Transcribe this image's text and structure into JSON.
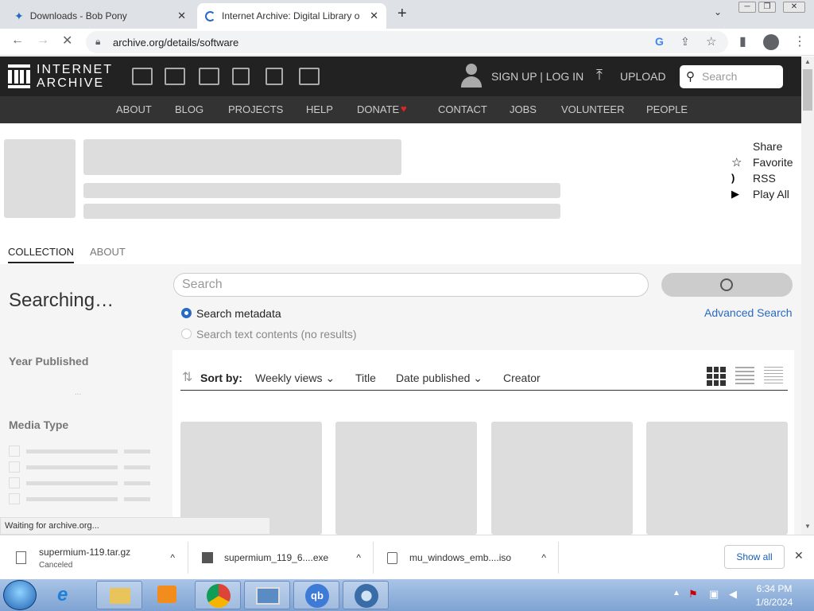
{
  "browser": {
    "tabs": [
      {
        "title": "Downloads - Bob Pony",
        "active": false
      },
      {
        "title": "Internet Archive: Digital Library o",
        "active": true
      }
    ],
    "url": "archive.org/details/software"
  },
  "ia": {
    "logo_line1": "INTERNET",
    "logo_line2": "ARCHIVE",
    "signup": "SIGN UP | LOG IN",
    "upload": "UPLOAD",
    "search_placeholder": "Search",
    "subnav": [
      "ABOUT",
      "BLOG",
      "PROJECTS",
      "HELP",
      "DONATE",
      "CONTACT",
      "JOBS",
      "VOLUNTEER",
      "PEOPLE"
    ]
  },
  "actions": {
    "share": "Share",
    "favorite": "Favorite",
    "rss": "RSS",
    "play_all": "Play All"
  },
  "tabs": {
    "collection": "COLLECTION",
    "about": "ABOUT"
  },
  "search": {
    "searching": "Searching…",
    "placeholder": "Search",
    "metadata": "Search metadata",
    "text_contents": "Search text contents (no results)",
    "advanced": "Advanced Search"
  },
  "facets": {
    "year": "Year Published",
    "media": "Media Type"
  },
  "sort": {
    "label": "Sort by:",
    "weekly": "Weekly views",
    "title": "Title",
    "date": "Date published",
    "creator": "Creator"
  },
  "status_text": "Waiting for archive.org...",
  "downloads": [
    {
      "name": "supermium-119.tar.gz",
      "status": "Canceled"
    },
    {
      "name": "supermium_119_6....exe",
      "status": ""
    },
    {
      "name": "mu_windows_emb....iso",
      "status": ""
    }
  ],
  "show_all": "Show all",
  "clock": {
    "time": "6:34 PM",
    "date": "1/8/2024"
  },
  "colors": {
    "accent": "#2869c1",
    "ia_bar": "#222222",
    "ia_subbar": "#333333",
    "donate_heart": "#e12424"
  }
}
